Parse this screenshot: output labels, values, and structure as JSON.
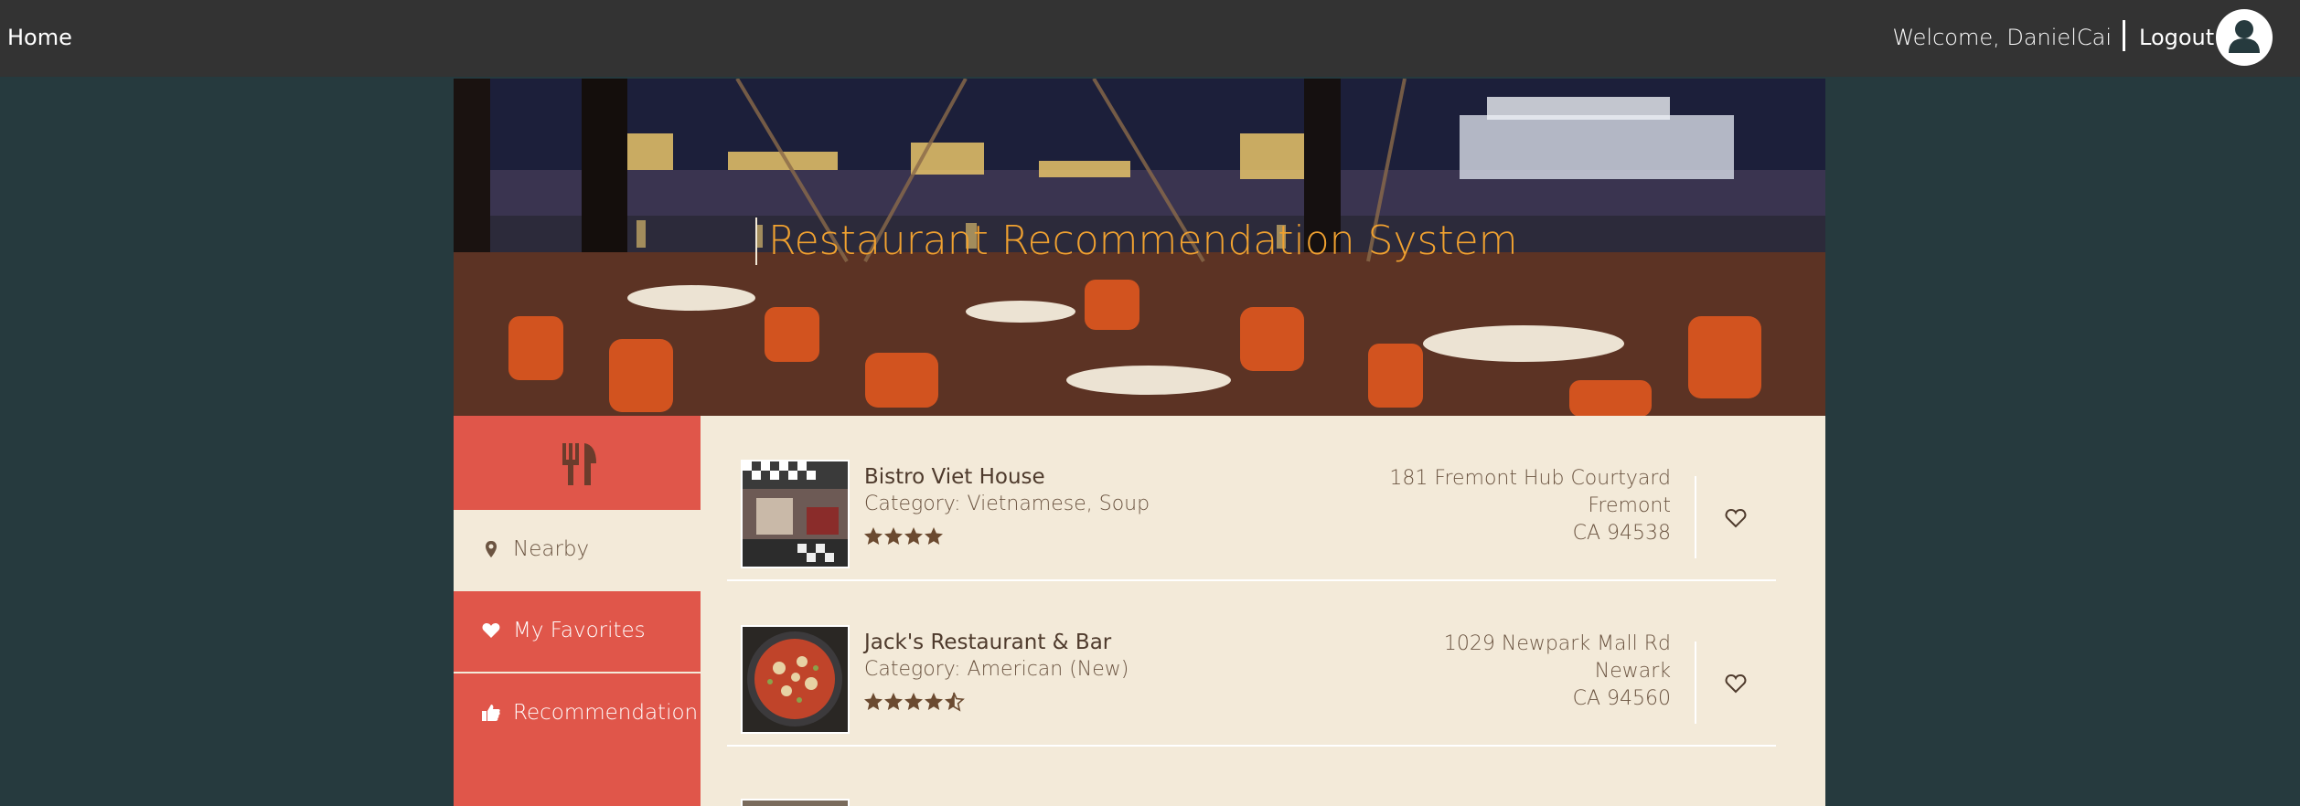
{
  "nav": {
    "home": "Home",
    "welcome": "Welcome, DanielCai",
    "logout": "Logout"
  },
  "hero": {
    "title": "Restaurant Recommendation System"
  },
  "sidebar": {
    "logo_icon": "utensils-icon",
    "items": [
      {
        "label": "Nearby",
        "icon": "map-marker-icon",
        "active": true
      },
      {
        "label": "My Favorites",
        "icon": "heart-icon",
        "active": false
      },
      {
        "label": "Recommendation",
        "icon": "thumbs-up-icon",
        "active": false
      }
    ]
  },
  "restaurants": [
    {
      "name": "Bistro Viet House",
      "category": "Category: Vietnamese, Soup",
      "rating": 4,
      "address": [
        "181 Fremont Hub Courtyard",
        "Fremont",
        "CA 94538"
      ],
      "favorite": false
    },
    {
      "name": "Jack's Restaurant & Bar",
      "category": "Category: American (New)",
      "rating": 4.5,
      "address": [
        "1029 Newpark Mall Rd",
        "Newark",
        "CA 94560"
      ],
      "favorite": false
    }
  ],
  "colors": {
    "topbar": "#333333",
    "page_bg": "#263a3e",
    "accent_red": "#e0564a",
    "cream": "#f3ead9",
    "title_orange": "#f0a130",
    "text_brown": "#6b5441"
  }
}
